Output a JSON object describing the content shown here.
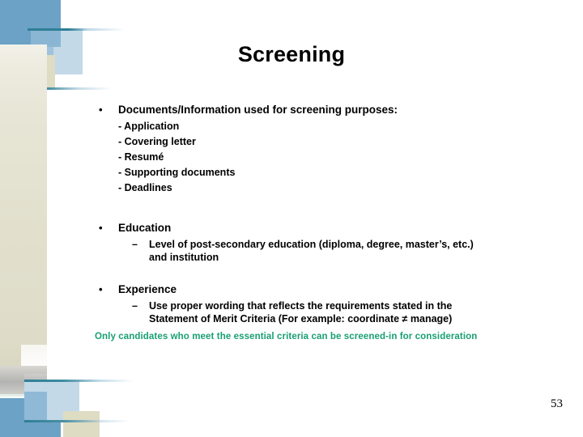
{
  "slide": {
    "title": "Screening",
    "page_number": "53",
    "note": "Only candidates who meet the essential criteria can be screened-in for consideration",
    "note_color": "#1aa071",
    "accent_blue": "#6ca2c6",
    "accent_light_blue": "#c3d9e8",
    "accent_beige": "#dedcc3",
    "accent_teal_line": "#2f7f96"
  },
  "bullets": [
    {
      "label": "Documents/Information used for screening purposes:",
      "marker": "•",
      "sub_dashes": [
        "- Application",
        "- Covering letter",
        "- Resumé",
        "- Supporting documents",
        "- Deadlines"
      ]
    },
    {
      "label": "Education",
      "marker": "•",
      "sub_items": [
        {
          "dash": "–",
          "line1": "Level of post-secondary education (diploma, degree, master’s, etc.)",
          "line2": "and institution"
        }
      ]
    },
    {
      "label": "Experience",
      "marker": "•",
      "sub_items": [
        {
          "dash": "–",
          "line1": "Use proper wording that reflects the requirements stated in the",
          "line2": "Statement of Merit Criteria (For example: coordinate ≠ manage)"
        }
      ]
    }
  ]
}
